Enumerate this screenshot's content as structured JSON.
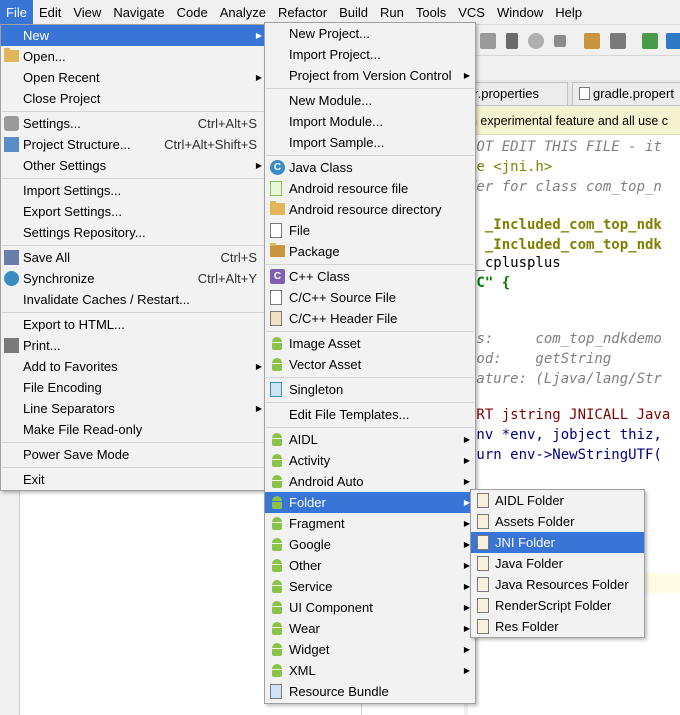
{
  "menubar": [
    "File",
    "Edit",
    "View",
    "Navigate",
    "Code",
    "Analyze",
    "Refactor",
    "Build",
    "Run",
    "Tools",
    "VCS",
    "Window",
    "Help"
  ],
  "tabs": [
    "r.properties",
    "gradle.propert"
  ],
  "editor": {
    "banner": "n experimental feature and all use c",
    "lines": [
      [
        "cmt",
        "NOT EDIT THIS FILE - it"
      ],
      [
        "mixed",
        "de <jni.h>"
      ],
      [
        "cmt",
        "der for class com_top_n"
      ],
      [
        "blank",
        ""
      ],
      [
        "mixed2",
        "f _Included_com_top_ndk"
      ],
      [
        "mixed3",
        "e _Included_com_top_ndk"
      ],
      [
        "plain",
        "__cplusplus"
      ],
      [
        "mixed4",
        "\"C\" {"
      ],
      [
        "blank",
        ""
      ],
      [
        "blank",
        ""
      ],
      [
        "cmt",
        "ss:     com_top_ndkdemo"
      ],
      [
        "cmt",
        "hod:    getString"
      ],
      [
        "cmt",
        "nature: (Ljava/lang/Str"
      ],
      [
        "blank",
        ""
      ],
      [
        "mixed5",
        "ORT jstring JNICALL Java"
      ],
      [
        "mixed6",
        "Env *env, jobject thiz,"
      ],
      [
        "mixed7",
        "turn env->NewStringUTF("
      ]
    ]
  },
  "file_menu": [
    {
      "label": "New",
      "arrow": true,
      "selected": true
    },
    {
      "label": "Open...",
      "icon": "folder-icon"
    },
    {
      "label": "Open Recent",
      "arrow": true
    },
    {
      "label": "Close Project"
    },
    {
      "sep": true
    },
    {
      "label": "Settings...",
      "shortcut": "Ctrl+Alt+S",
      "icon": "wrench-icon"
    },
    {
      "label": "Project Structure...",
      "shortcut": "Ctrl+Alt+Shift+S",
      "icon": "project-structure-icon"
    },
    {
      "label": "Other Settings",
      "arrow": true
    },
    {
      "sep": true
    },
    {
      "label": "Import Settings..."
    },
    {
      "label": "Export Settings..."
    },
    {
      "label": "Settings Repository..."
    },
    {
      "sep": true
    },
    {
      "label": "Save All",
      "shortcut": "Ctrl+S",
      "icon": "save-icon"
    },
    {
      "label": "Synchronize",
      "shortcut": "Ctrl+Alt+Y",
      "icon": "sync-icon"
    },
    {
      "label": "Invalidate Caches / Restart..."
    },
    {
      "sep": true
    },
    {
      "label": "Export to HTML..."
    },
    {
      "label": "Print...",
      "icon": "print-icon"
    },
    {
      "label": "Add to Favorites",
      "arrow": true
    },
    {
      "label": "File Encoding"
    },
    {
      "label": "Line Separators",
      "arrow": true
    },
    {
      "label": "Make File Read-only"
    },
    {
      "sep": true
    },
    {
      "label": "Power Save Mode"
    },
    {
      "sep": true
    },
    {
      "label": "Exit"
    }
  ],
  "new_menu": [
    {
      "label": "New Project..."
    },
    {
      "label": "Import Project..."
    },
    {
      "label": "Project from Version Control",
      "arrow": true
    },
    {
      "sep": true
    },
    {
      "label": "New Module..."
    },
    {
      "label": "Import Module..."
    },
    {
      "label": "Import Sample..."
    },
    {
      "sep": true
    },
    {
      "label": "Java Class",
      "icon": "java-class-icon"
    },
    {
      "label": "Android resource file",
      "icon": "android-resource-file-icon"
    },
    {
      "label": "Android resource directory",
      "icon": "folder-icon"
    },
    {
      "label": "File",
      "icon": "file-icon"
    },
    {
      "label": "Package",
      "icon": "package-icon"
    },
    {
      "sep": true
    },
    {
      "label": "C++ Class",
      "icon": "cpp-class-icon"
    },
    {
      "label": "C/C++ Source File",
      "icon": "cpp-source-icon"
    },
    {
      "label": "C/C++ Header File",
      "icon": "cpp-header-icon"
    },
    {
      "sep": true
    },
    {
      "label": "Image Asset",
      "icon": "android-icon"
    },
    {
      "label": "Vector Asset",
      "icon": "android-icon"
    },
    {
      "sep": true
    },
    {
      "label": "Singleton",
      "icon": "singleton-icon"
    },
    {
      "sep": true
    },
    {
      "label": "Edit File Templates..."
    },
    {
      "sep": true
    },
    {
      "label": "AIDL",
      "icon": "android-icon",
      "arrow": true
    },
    {
      "label": "Activity",
      "icon": "android-icon",
      "arrow": true
    },
    {
      "label": "Android Auto",
      "icon": "android-icon",
      "arrow": true
    },
    {
      "label": "Folder",
      "icon": "android-icon",
      "arrow": true,
      "selected": true
    },
    {
      "label": "Fragment",
      "icon": "android-icon",
      "arrow": true
    },
    {
      "label": "Google",
      "icon": "android-icon",
      "arrow": true
    },
    {
      "label": "Other",
      "icon": "android-icon",
      "arrow": true
    },
    {
      "label": "Service",
      "icon": "android-icon",
      "arrow": true
    },
    {
      "label": "UI Component",
      "icon": "android-icon",
      "arrow": true
    },
    {
      "label": "Wear",
      "icon": "android-icon",
      "arrow": true
    },
    {
      "label": "Widget",
      "icon": "android-icon",
      "arrow": true
    },
    {
      "label": "XML",
      "icon": "android-icon",
      "arrow": true
    },
    {
      "label": "Resource Bundle",
      "icon": "resource-bundle-icon"
    }
  ],
  "folder_menu": [
    {
      "label": "AIDL Folder"
    },
    {
      "label": "Assets Folder"
    },
    {
      "label": "JNI Folder",
      "selected": true
    },
    {
      "label": "Java Folder"
    },
    {
      "label": "Java Resources Folder"
    },
    {
      "label": "RenderScript Folder"
    },
    {
      "label": "Res Folder"
    }
  ],
  "colors": {
    "selection": "#3875d7",
    "android_green": "#8bc34a",
    "folder": "#e3b55a"
  }
}
